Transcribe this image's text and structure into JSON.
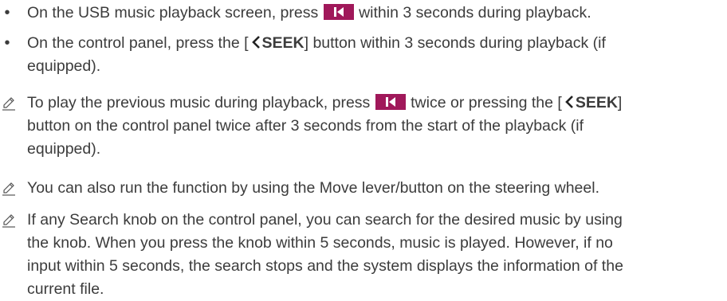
{
  "colors": {
    "text": "#3c3c3c",
    "button_bg": "#a0185a",
    "button_glyph": "#ffffff"
  },
  "icons": {
    "bullet": "bullet-dot",
    "note": "pencil-note-icon",
    "previous": "skip-previous-icon",
    "chevron": "chevron-left-icon"
  },
  "bullets": [
    {
      "lines": [
        [
          {
            "t": "text",
            "v": "On the USB music playback screen, press "
          },
          {
            "t": "btn"
          },
          {
            "t": "text",
            "v": " within 3 seconds during playback."
          }
        ]
      ]
    },
    {
      "lines": [
        [
          {
            "t": "text",
            "v": "On the control panel, press the ["
          },
          {
            "t": "chev"
          },
          {
            "t": "bold",
            "v": "SEEK"
          },
          {
            "t": "text",
            "v": "] button within 3 seconds during playback (if"
          }
        ],
        [
          {
            "t": "text",
            "v": "equipped)."
          }
        ]
      ]
    }
  ],
  "notes": [
    {
      "lines": [
        [
          {
            "t": "text",
            "v": "To play the previous music during playback, press "
          },
          {
            "t": "btn"
          },
          {
            "t": "text",
            "v": " twice or pressing the ["
          },
          {
            "t": "chev"
          },
          {
            "t": "bold",
            "v": "SEEK"
          },
          {
            "t": "text",
            "v": "]"
          }
        ],
        [
          {
            "t": "text",
            "v": "button on the control panel twice after 3 seconds from the start of the playback (if"
          }
        ],
        [
          {
            "t": "text",
            "v": "equipped)."
          }
        ]
      ]
    },
    {
      "lines": [
        [
          {
            "t": "text",
            "v": "You can also run the function by using the Move lever/button on the steering wheel."
          }
        ]
      ]
    },
    {
      "lines": [
        [
          {
            "t": "text",
            "v": "If any Search knob on the control panel, you can search for the desired music by using"
          }
        ],
        [
          {
            "t": "text",
            "v": "the knob. When you press the knob within 5 seconds, music is played. However, if no"
          }
        ],
        [
          {
            "t": "text",
            "v": "input within 5 seconds, the search stops and the system displays the information of the"
          }
        ],
        [
          {
            "t": "text",
            "v": "current file."
          }
        ]
      ]
    }
  ]
}
